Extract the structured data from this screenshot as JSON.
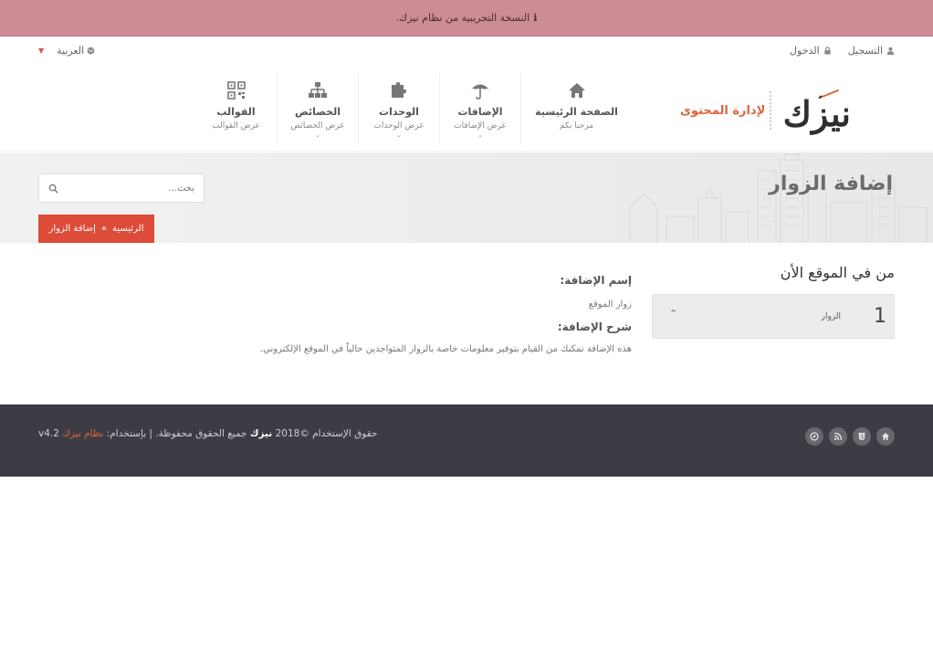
{
  "trial": {
    "icon": "info-icon",
    "text": "النسخة التجريبية من نظام نيزك."
  },
  "topbar": {
    "register": "التسجيل",
    "login": "الدخول",
    "language": "العربية"
  },
  "logo": {
    "main": "نيزك",
    "sub": "لإدارة المحتوى"
  },
  "nav": [
    {
      "title": "الصفحة الرئيسية",
      "sub": "مرحبا بكم",
      "icon": "home-icon"
    },
    {
      "title": "الإضافات",
      "sub": "عرض الإضافات",
      "icon": "umbrella-icon"
    },
    {
      "title": "الوحدات",
      "sub": "عرض الوحدات",
      "icon": "puzzle-icon"
    },
    {
      "title": "الخصائص",
      "sub": "عرض الخصائص",
      "icon": "sitemap-icon"
    },
    {
      "title": "القوالب",
      "sub": "عرض القوالب",
      "icon": "qrcode-icon"
    }
  ],
  "banner": {
    "title": "إضافة الزوار",
    "search_placeholder": "بحث...",
    "breadcrumb_home": "الرئيسية",
    "breadcrumb_sep": "»",
    "breadcrumb_current": "إضافة الزوار"
  },
  "sidebar": {
    "title": "من في الموقع الأن",
    "widget_count": "1",
    "widget_label": "الزوار"
  },
  "content": {
    "name_heading": "إسم الإضافة:",
    "name_value": "زوار الموقع",
    "desc_heading": "شرح الإضافة:",
    "desc_value": "هذه الإضافة تمكنك من القيام بتوفير معلومات خاصة بالزوار المتواجدين حالياً في الموقع الإلكتروني."
  },
  "footer": {
    "copy_prefix": "حقوق الإستخدام ©2018",
    "brand": "نيزك",
    "copy_mid": "جميع الحقوق محفوظة. | بإستخدام:",
    "system": "نظام نيزك",
    "version": "v4.2"
  }
}
